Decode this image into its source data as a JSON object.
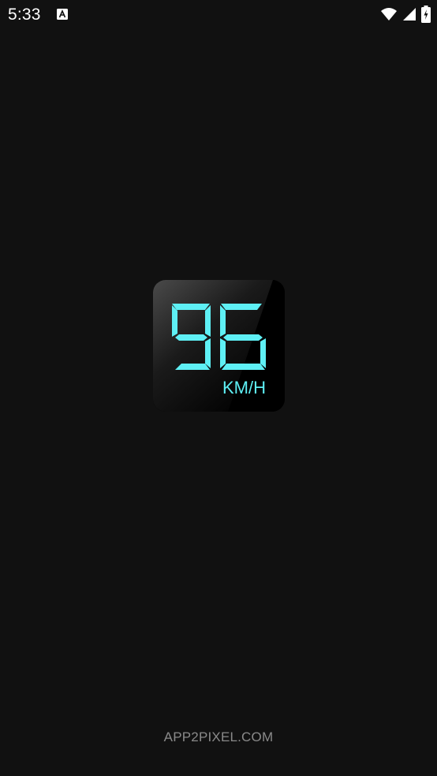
{
  "status_bar": {
    "time": "5:33",
    "notification_icon": "a-box-icon",
    "icons": [
      "wifi-icon",
      "signal-icon",
      "battery-charging-icon"
    ]
  },
  "splash": {
    "speed_value": "96",
    "speed_unit": "KM/H",
    "accent_color": "#5ef0f5"
  },
  "footer": {
    "watermark": "APP2PIXEL.COM"
  }
}
